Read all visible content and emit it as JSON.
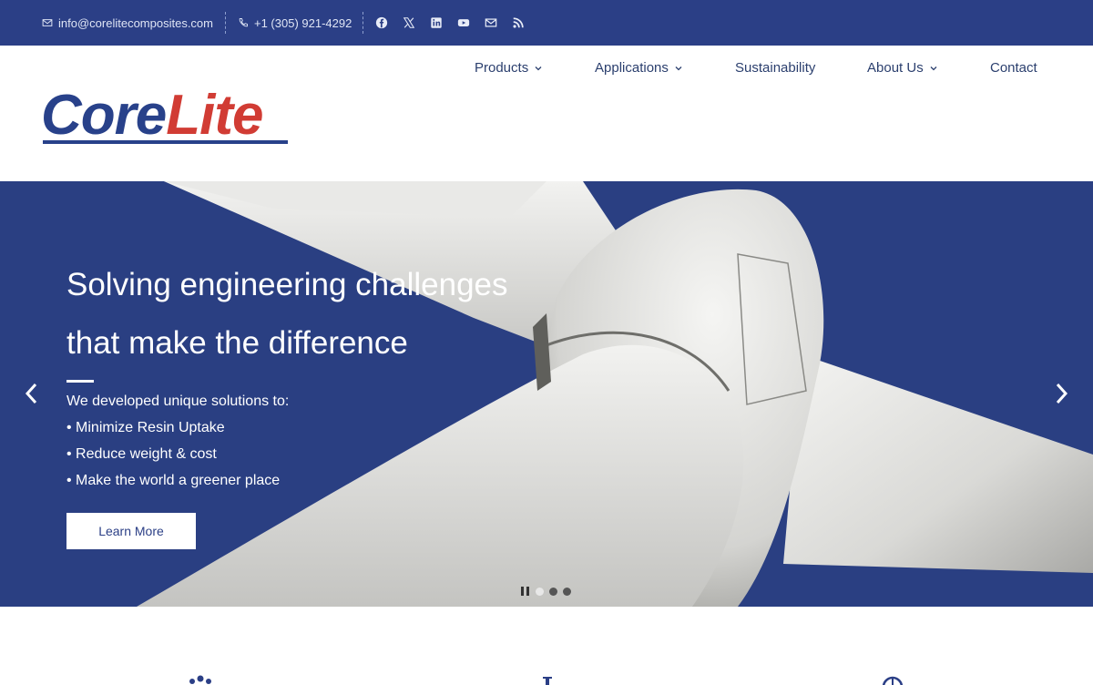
{
  "topbar": {
    "email": "info@corelitecomposites.com",
    "phone": "+1 (305) 921-4292",
    "icons": [
      "mail-icon",
      "phone-icon",
      "facebook-icon",
      "x-icon",
      "linkedin-icon",
      "youtube-icon",
      "mail-icon",
      "rss-icon"
    ]
  },
  "brand": {
    "part1": "Core",
    "part2": "Lite",
    "primary_color": "#28418a",
    "accent_color": "#d13c34",
    "bar_color": "#2b3f86"
  },
  "nav": {
    "items": [
      {
        "label": "Products",
        "has_dropdown": true
      },
      {
        "label": "Applications",
        "has_dropdown": true
      },
      {
        "label": "Sustainability",
        "has_dropdown": false
      },
      {
        "label": "About Us",
        "has_dropdown": true
      },
      {
        "label": "Contact",
        "has_dropdown": false
      }
    ]
  },
  "hero": {
    "title_line1": "Solving engineering challenges",
    "title_line2": "that make the difference",
    "intro": "We developed unique solutions to:",
    "bullets": [
      "• Minimize Resin Uptake",
      "• Reduce weight & cost",
      "• Make the world a greener place"
    ],
    "cta": "Learn More",
    "slides": 3,
    "active_slide": 1
  }
}
